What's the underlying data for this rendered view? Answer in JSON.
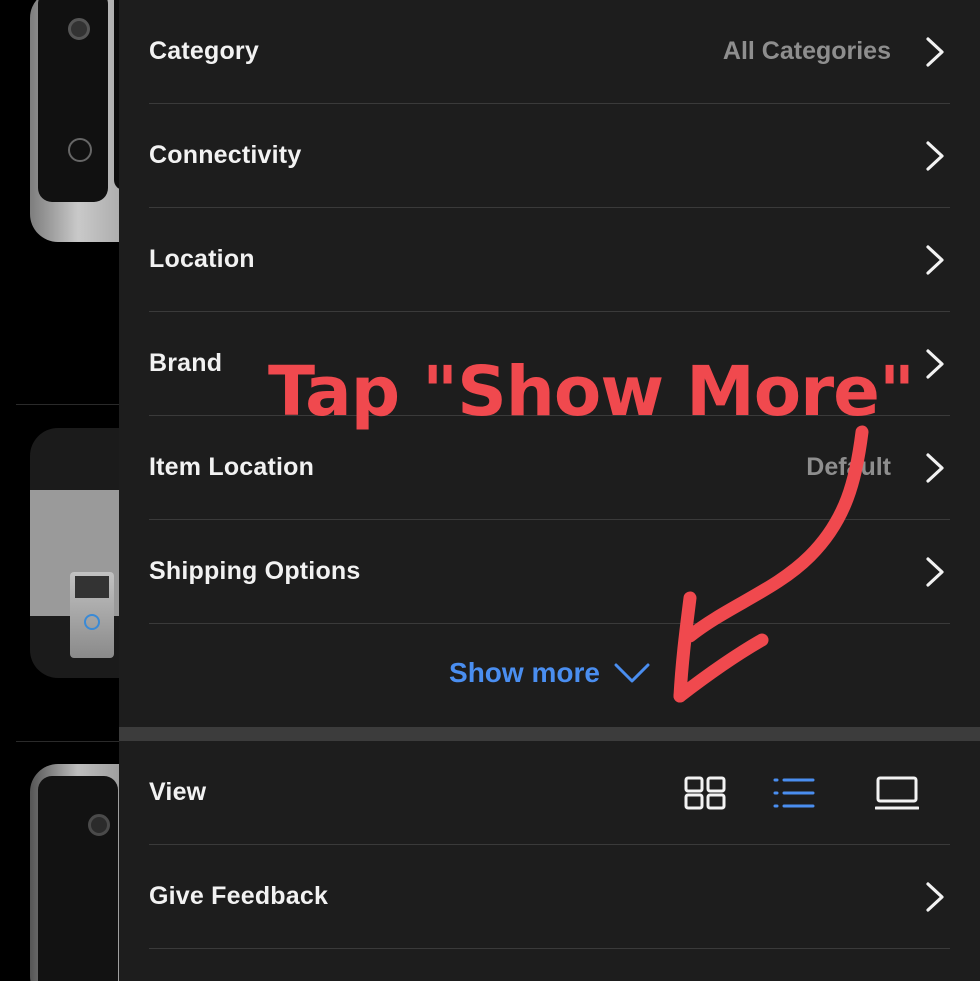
{
  "filters": [
    {
      "label": "Category",
      "value": "All Categories"
    },
    {
      "label": "Connectivity",
      "value": ""
    },
    {
      "label": "Location",
      "value": ""
    },
    {
      "label": "Brand",
      "value": ""
    },
    {
      "label": "Item Location",
      "value": "Default"
    },
    {
      "label": "Shipping Options",
      "value": ""
    }
  ],
  "show_more_label": "Show more",
  "view": {
    "label": "View",
    "modes": [
      "grid-view-icon",
      "list-view-icon",
      "gallery-view-icon"
    ],
    "selected": "list-view-icon"
  },
  "feedback_label": "Give Feedback",
  "annotation": {
    "text": "Tap \"Show More\"",
    "color": "#f0494e"
  },
  "colors": {
    "panel_bg": "#1d1d1d",
    "accent_blue": "#4a8ef0",
    "text_primary": "#f2f2f2",
    "text_secondary": "#8e8e8e",
    "divider": "#3a3a3a"
  }
}
